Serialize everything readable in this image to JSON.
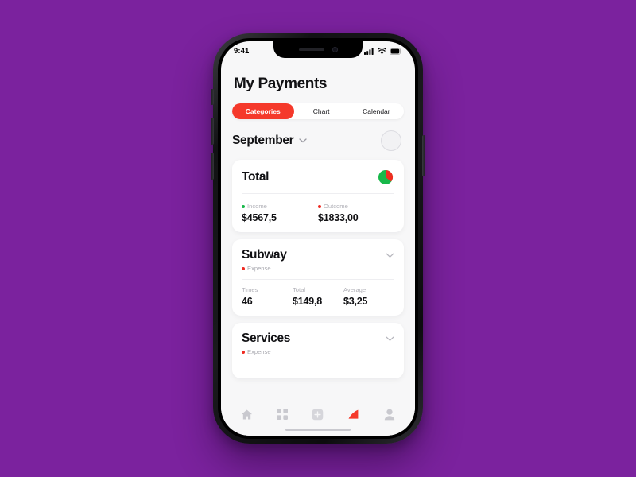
{
  "background_color": "#7B229E",
  "phone": {
    "status_bar": {
      "time": "9:41",
      "icons": [
        "cellular-signal-icon",
        "wifi-icon",
        "battery-icon"
      ]
    },
    "home_indicator": true
  },
  "app": {
    "header": {
      "title": "My Payments"
    },
    "segmented_control": {
      "active": "Categories",
      "options": [
        {
          "label": "Categories",
          "active": true
        },
        {
          "label": "Chart",
          "active": false
        },
        {
          "label": "Calendar",
          "active": false
        }
      ]
    },
    "month_selector": {
      "label": "September",
      "chevron_icon": "chevron-down-icon",
      "avatar_placeholder": true
    },
    "cards": [
      {
        "id": "total",
        "title": "Total",
        "chart_icon": "pie-chart-icon",
        "stats": [
          {
            "label": "Income",
            "value": "$4567,5",
            "dot_color": "#18b84a"
          },
          {
            "label": "Outcome",
            "value": "$1833,00",
            "dot_color": "#ef2b22"
          }
        ]
      },
      {
        "id": "subway",
        "title": "Subway",
        "tag": "Expense",
        "tag_dot_color": "#ef2b22",
        "chevron_icon": "chevron-down-icon",
        "stats": [
          {
            "label": "Times",
            "value": "46"
          },
          {
            "label": "Total",
            "value": "$149,8"
          },
          {
            "label": "Average",
            "value": "$3,25"
          }
        ]
      },
      {
        "id": "services",
        "title": "Services",
        "tag": "Expense",
        "tag_dot_color": "#ef2b22",
        "chevron_icon": "chevron-down-icon"
      }
    ],
    "tab_bar": {
      "active": "statistics",
      "items": [
        {
          "id": "home",
          "icon": "home-icon",
          "active": false
        },
        {
          "id": "categories",
          "icon": "grid-icon",
          "active": false
        },
        {
          "id": "add",
          "icon": "plus-square-icon",
          "active": false
        },
        {
          "id": "statistics",
          "icon": "bar-chart-icon",
          "active": true
        },
        {
          "id": "profile",
          "icon": "person-icon",
          "active": false
        }
      ]
    },
    "colors": {
      "accent_red": "#F5392B",
      "income_green": "#18b84a",
      "outcome_red": "#ef2b22",
      "screen_bg": "#f7f7f8",
      "card_bg": "#ffffff"
    }
  },
  "chart_data": {
    "type": "pie",
    "title": "Total",
    "categories": [
      "Income",
      "Outcome"
    ],
    "values": [
      4567.5,
      1833.0
    ],
    "colors": [
      "#18b84a",
      "#ef2b22"
    ],
    "legend": [
      "Income",
      "Outcome"
    ],
    "labels": [
      "$4567,5",
      "$1833,00"
    ]
  }
}
